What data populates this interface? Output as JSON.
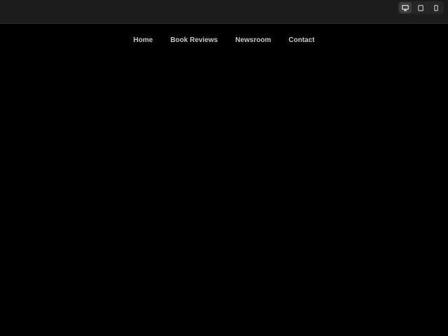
{
  "device_switcher": {
    "active": "desktop",
    "items": [
      {
        "icon": "desktop-icon"
      },
      {
        "icon": "tablet-icon"
      },
      {
        "icon": "mobile-icon"
      }
    ]
  },
  "nav": {
    "items": [
      {
        "label": "Home"
      },
      {
        "label": "Book Reviews"
      },
      {
        "label": "Newsroom"
      },
      {
        "label": "Contact"
      }
    ]
  },
  "colors": {
    "background": "#000000",
    "toolbar": "#1c1c1c",
    "nav_text": "#c8c8c8",
    "icon": "#bdbdbd"
  }
}
